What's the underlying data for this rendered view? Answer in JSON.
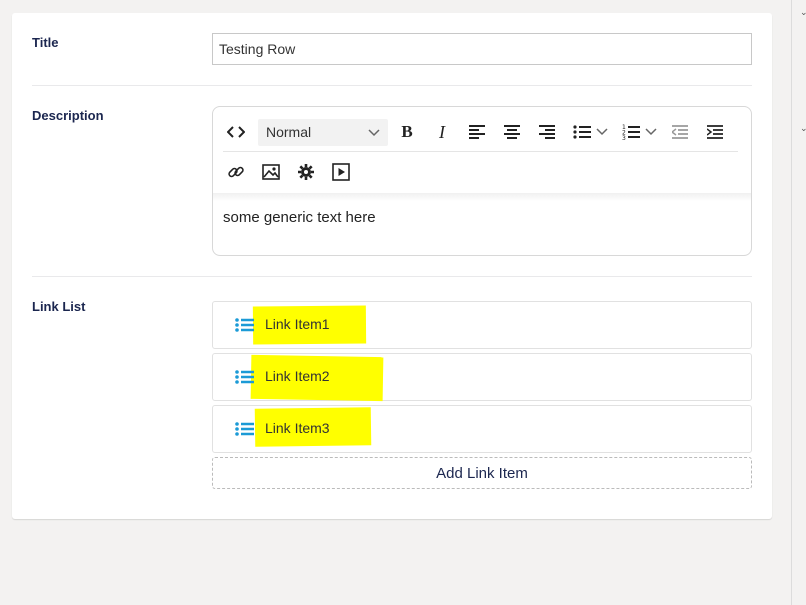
{
  "fields": {
    "title": {
      "label": "Title",
      "value": "Testing Row"
    },
    "description": {
      "label": "Description",
      "format_select": "Normal",
      "content": "some generic text here",
      "toolbar_icons": [
        "code-icon",
        "bold-icon",
        "italic-icon",
        "align-left-icon",
        "align-center-icon",
        "align-right-icon",
        "bullet-list-icon",
        "ordered-list-icon",
        "outdent-icon",
        "indent-icon",
        "link-icon",
        "image-icon",
        "settings-icon",
        "media-icon"
      ],
      "bold_glyph": "B",
      "italic_glyph": "I"
    },
    "link_list": {
      "label": "Link List",
      "items": [
        "Link Item1",
        "Link Item2",
        "Link Item3"
      ],
      "add_label": "Add Link Item",
      "icon_color": "#1b9ad6",
      "highlight_color": "#ffff00"
    }
  }
}
